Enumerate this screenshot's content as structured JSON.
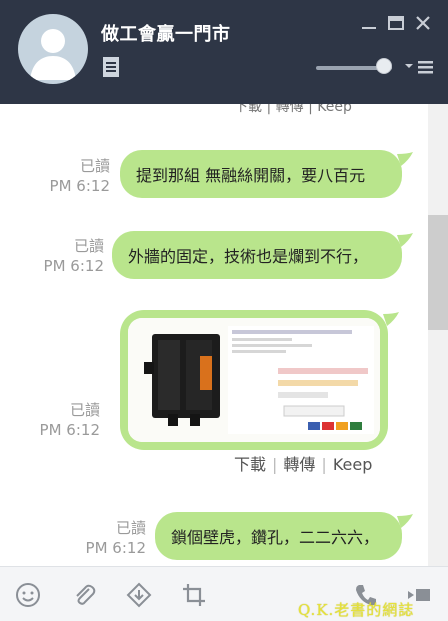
{
  "window": {
    "title": "做工會贏一門市",
    "icons": [
      "note-icon",
      "minimize-icon",
      "maximize-icon",
      "close-icon",
      "dropdown-icon",
      "menu-icon"
    ]
  },
  "chat": {
    "top_actions_partial": "下載  |  轉傳  |  Keep",
    "messages": [
      {
        "read": "已讀",
        "time": "PM 6:12",
        "text": "提到那組 無融絲開關，要八百元"
      },
      {
        "read": "已讀",
        "time": "PM 6:12",
        "text": "外牆的固定，技術也是爛到不行，"
      },
      {
        "read": "已讀",
        "time": "PM 6:12",
        "type": "image"
      },
      {
        "read": "已讀",
        "time": "PM 6:12",
        "text": "鎖個壁虎，鑽孔，二二六六，"
      }
    ],
    "image_actions": {
      "download": "下載",
      "forward": "轉傳",
      "keep": "Keep"
    },
    "bubble_color": "#b9e58c"
  },
  "toolbar": {
    "icons": [
      "emoji-icon",
      "attach-icon",
      "download-icon",
      "crop-icon",
      "phone-icon",
      "video-icon"
    ],
    "watermark": "Q.K.老書的網誌"
  }
}
